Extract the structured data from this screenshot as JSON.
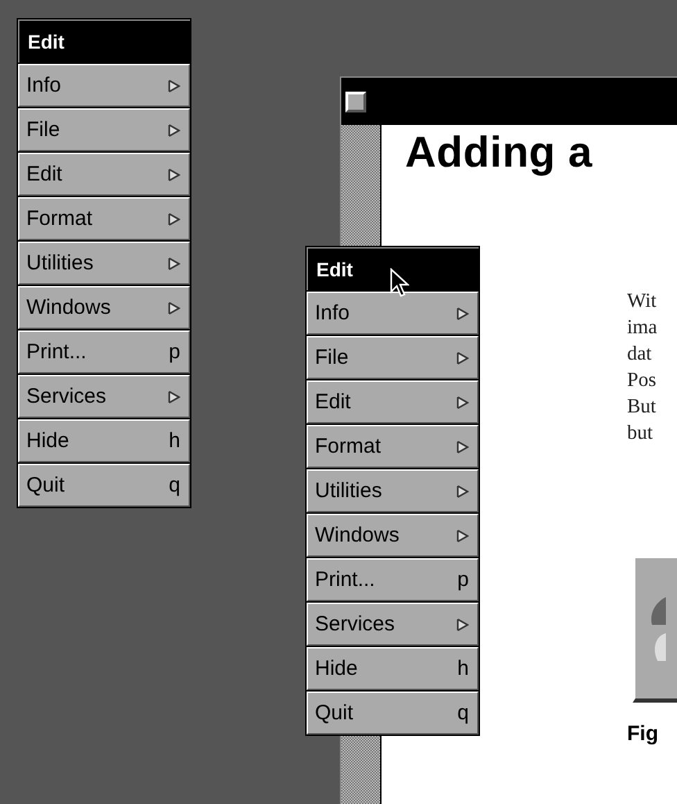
{
  "menus": [
    {
      "title": "Edit",
      "items": [
        {
          "label": "Info",
          "kind": "submenu"
        },
        {
          "label": "File",
          "kind": "submenu"
        },
        {
          "label": "Edit",
          "kind": "submenu"
        },
        {
          "label": "Format",
          "kind": "submenu"
        },
        {
          "label": "Utilities",
          "kind": "submenu"
        },
        {
          "label": "Windows",
          "kind": "submenu"
        },
        {
          "label": "Print...",
          "kind": "command",
          "shortcut": "p"
        },
        {
          "label": "Services",
          "kind": "submenu"
        },
        {
          "label": "Hide",
          "kind": "command",
          "shortcut": "h"
        },
        {
          "label": "Quit",
          "kind": "command",
          "shortcut": "q"
        }
      ]
    },
    {
      "title": "Edit",
      "items": [
        {
          "label": "Info",
          "kind": "submenu"
        },
        {
          "label": "File",
          "kind": "submenu"
        },
        {
          "label": "Edit",
          "kind": "submenu"
        },
        {
          "label": "Format",
          "kind": "submenu"
        },
        {
          "label": "Utilities",
          "kind": "submenu"
        },
        {
          "label": "Windows",
          "kind": "submenu"
        },
        {
          "label": "Print...",
          "kind": "command",
          "shortcut": "p"
        },
        {
          "label": "Services",
          "kind": "submenu"
        },
        {
          "label": "Hide",
          "kind": "command",
          "shortcut": "h"
        },
        {
          "label": "Quit",
          "kind": "command",
          "shortcut": "q"
        }
      ]
    }
  ],
  "window": {
    "heading": "Adding a",
    "body_lines": [
      "Wit",
      "ima",
      "dat",
      "Pos",
      "But",
      "but"
    ],
    "caption": "Fig"
  }
}
